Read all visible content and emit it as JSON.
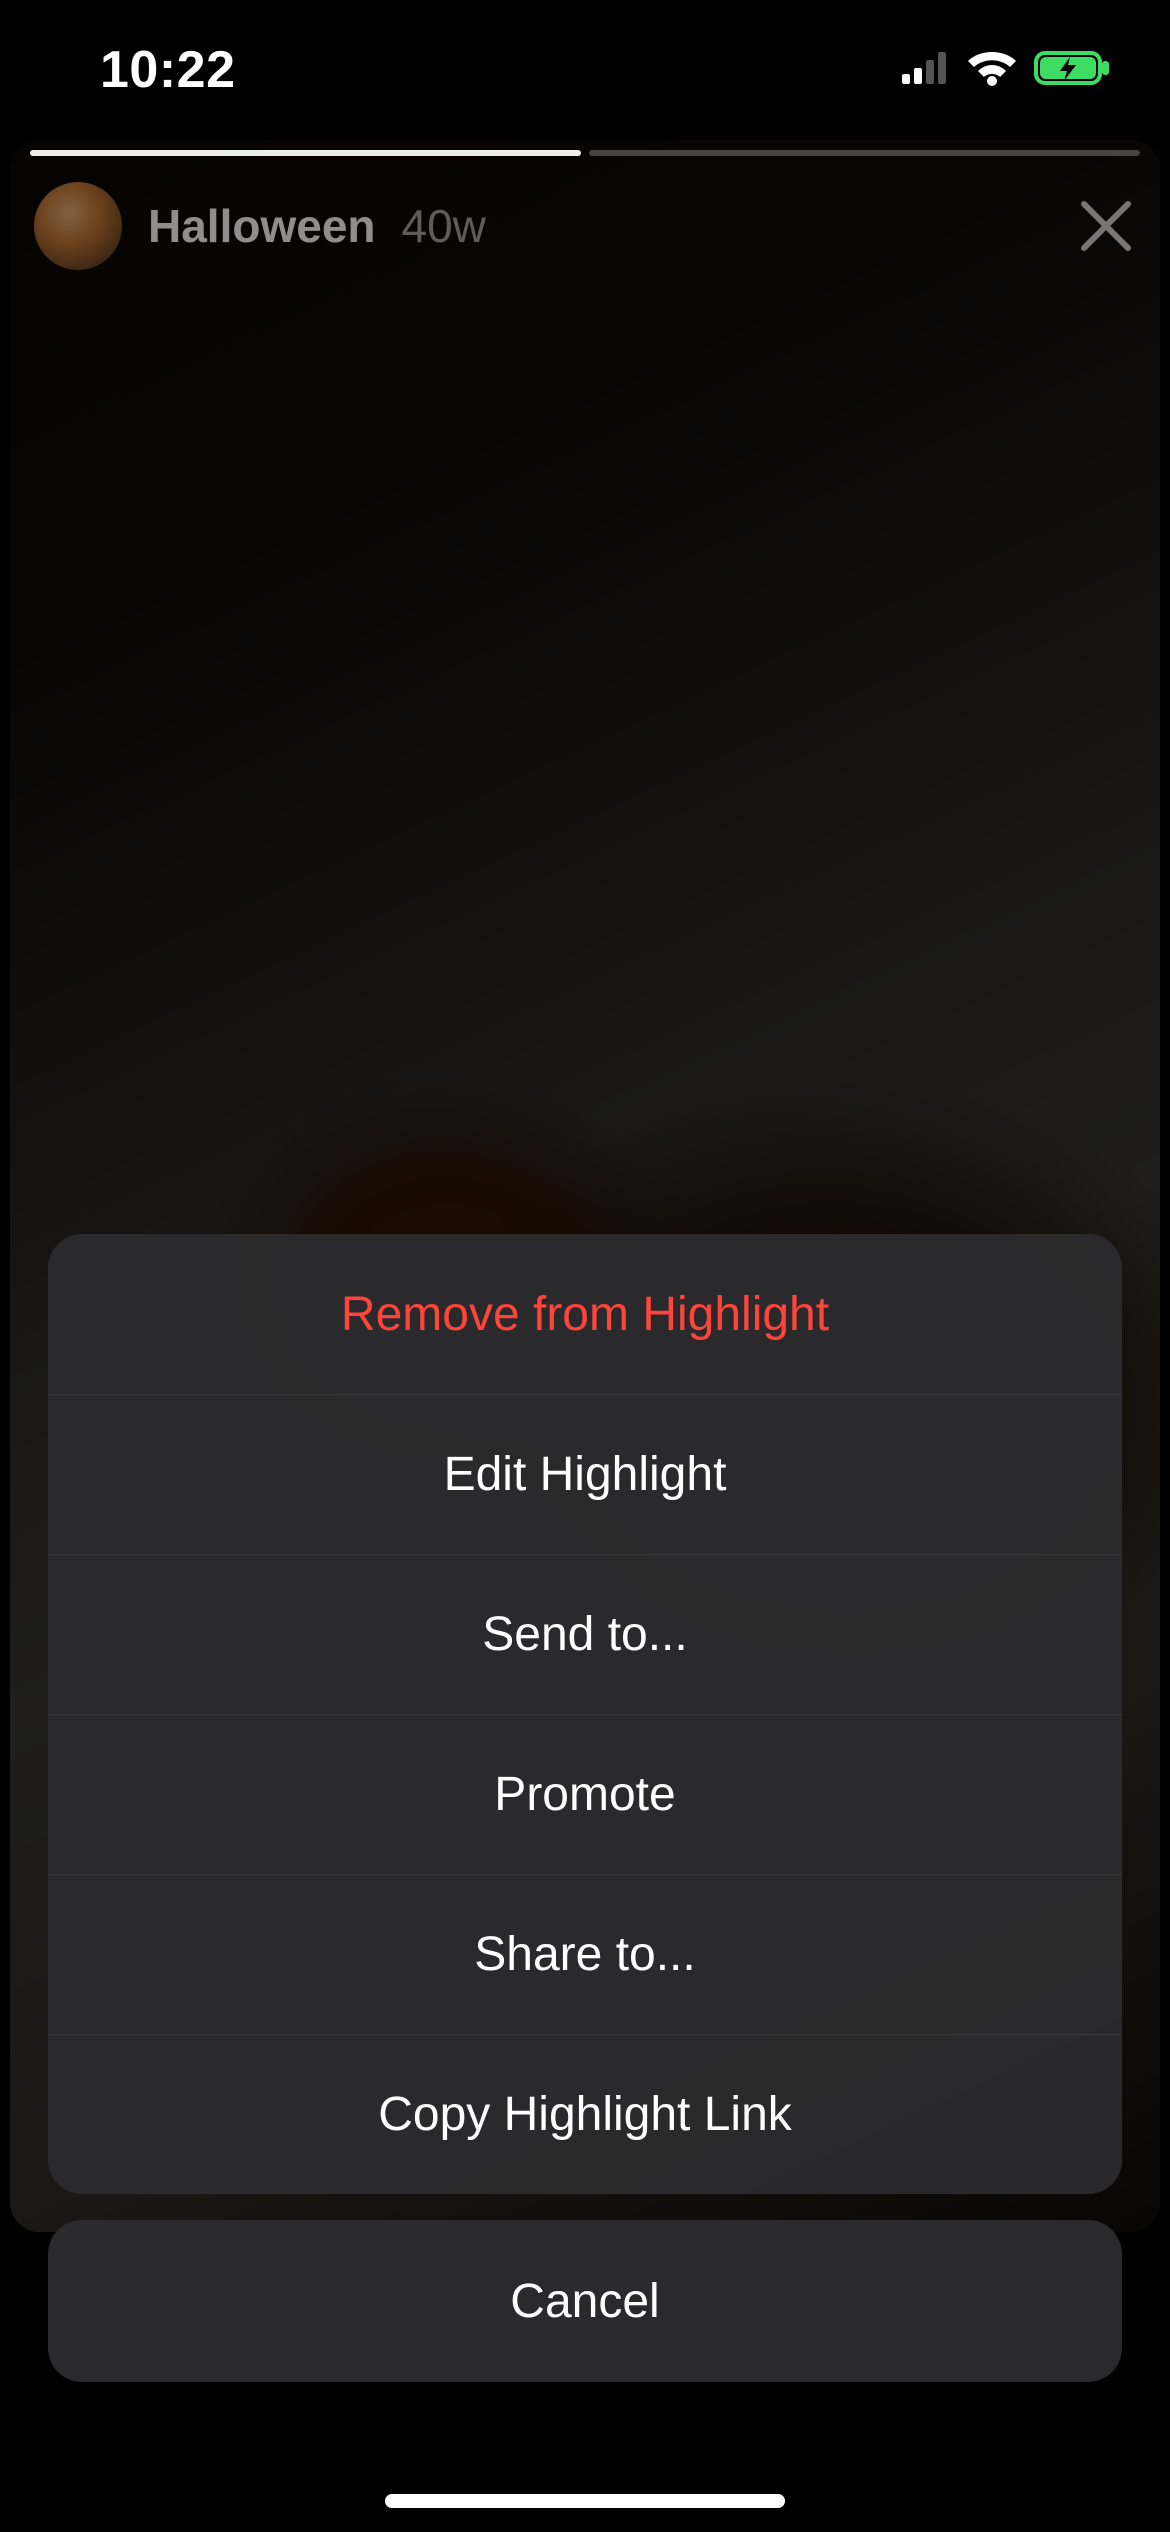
{
  "status": {
    "time": "10:22"
  },
  "story": {
    "title": "Halloween",
    "age": "40w",
    "progress_segments": 2,
    "progress_current": 0,
    "progress_fill_pct": 100
  },
  "action_sheet": {
    "items": [
      {
        "label": "Remove from Highlight",
        "destructive": true
      },
      {
        "label": "Edit Highlight",
        "destructive": false
      },
      {
        "label": "Send to...",
        "destructive": false
      },
      {
        "label": "Promote",
        "destructive": false
      },
      {
        "label": "Share to...",
        "destructive": false
      },
      {
        "label": "Copy Highlight Link",
        "destructive": false
      }
    ],
    "cancel": "Cancel"
  }
}
